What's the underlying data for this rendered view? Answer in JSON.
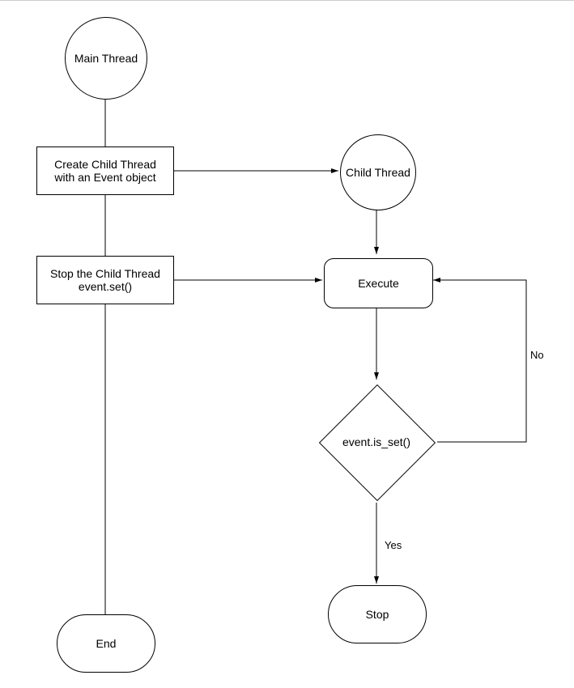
{
  "nodes": {
    "mainThread": "Main Thread",
    "createChild": "Create Child Thread\nwith an Event object",
    "stopChild": "Stop the Child Thread\nevent.set()",
    "end": "End",
    "childThread": "Child Thread",
    "execute": "Execute",
    "decision": "event.is_set()",
    "stop": "Stop"
  },
  "edges": {
    "yes": "Yes",
    "no": "No"
  }
}
